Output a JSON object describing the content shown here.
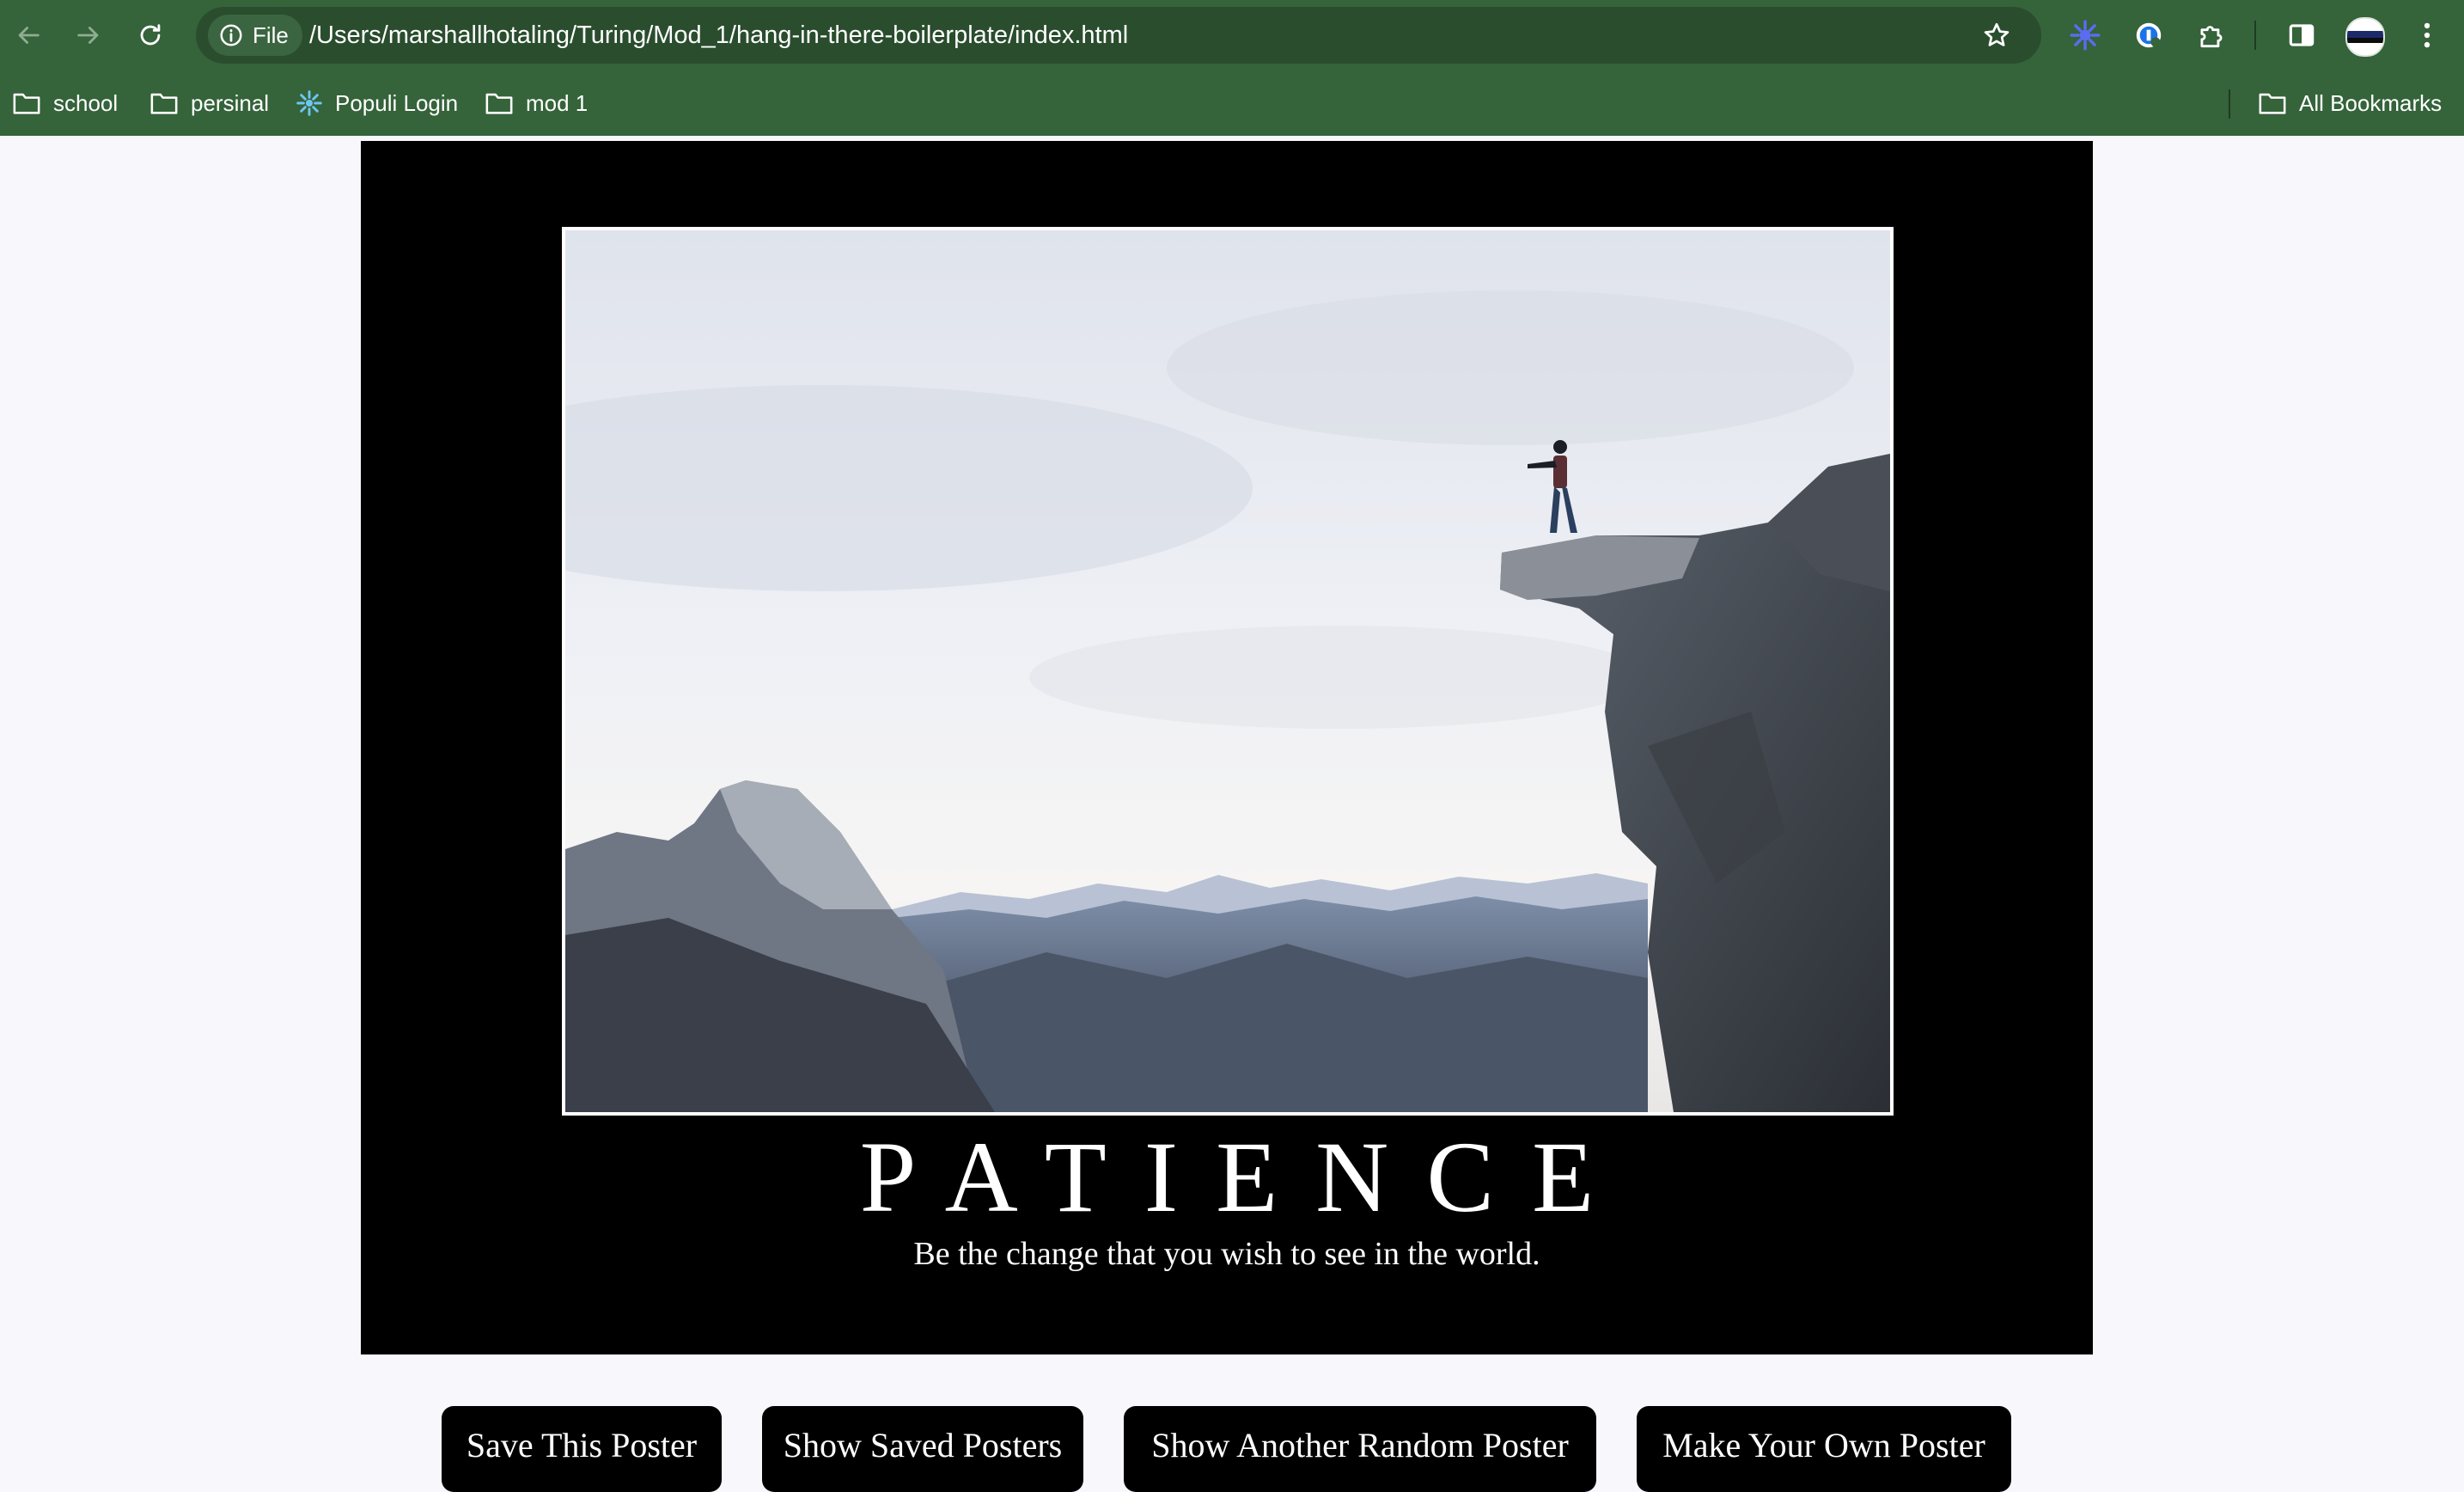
{
  "browser": {
    "file_chip_label": "File",
    "url": "/Users/marshallhotaling/Turing/Mod_1/hang-in-there-boilerplate/index.html",
    "bookmarks": [
      {
        "label": "school",
        "icon": "folder-icon"
      },
      {
        "label": "persinal",
        "icon": "folder-icon"
      },
      {
        "label": "Populi Login",
        "icon": "populi-icon"
      },
      {
        "label": "mod 1",
        "icon": "folder-icon"
      }
    ],
    "all_bookmarks_label": "All Bookmarks",
    "colors": {
      "frame": "#35633a",
      "omnibox": "#2a4d2e"
    }
  },
  "poster": {
    "title": "PATIENCE",
    "quote": "Be the change that you wish to see in the world.",
    "image_subject": "person standing on rock ledge overlooking mountain valley"
  },
  "buttons": {
    "save": "Save This Poster",
    "show_saved": "Show Saved Posters",
    "random": "Show Another Random Poster",
    "make_own": "Make Your Own Poster"
  },
  "colors": {
    "page_bg": "#f8f7fc",
    "poster_bg": "#000000",
    "button_bg": "#000000",
    "button_text": "#ffffff"
  }
}
